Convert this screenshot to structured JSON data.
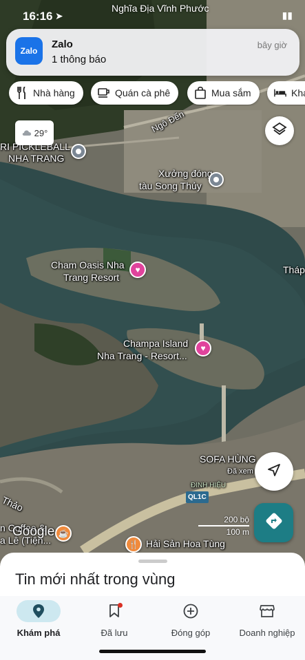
{
  "status_bar": {
    "time": "16:16",
    "location_label": "Nghĩa Địa Vĩnh Phước"
  },
  "notification": {
    "app_icon_text": "Zalo",
    "title": "Zalo",
    "body": "1 thông báo",
    "time": "bây giờ"
  },
  "chips": [
    {
      "label": "Nhà hàng",
      "icon": "restaurant-icon"
    },
    {
      "label": "Quán cà phê",
      "icon": "coffee-icon"
    },
    {
      "label": "Mua sắm",
      "icon": "shopping-bag-icon"
    },
    {
      "label": "Khá",
      "icon": "hotel-icon"
    }
  ],
  "weather": {
    "temp": "29°",
    "icon": "cloud-icon"
  },
  "map_labels": {
    "road_ngo_den": "Ngô Đến",
    "pickleball_1": "RI PICKLEBALL",
    "pickleball_2": "NHA TRANG",
    "shipyard_1": "Xưởng đóng",
    "shipyard_2": "tàu Song Thủy",
    "cham_oasis_1": "Cham Oasis Nha",
    "cham_oasis_2": "Trang Resort",
    "thap": "Tháp",
    "champa_1": "Champa Island",
    "champa_2": "Nha Trang - Resort...",
    "sofa": "SOFA HÙNG",
    "sofa_sub": "Đã xem",
    "dinh_hieu": "ĐINH HIỆU",
    "ql1c": "QL1C",
    "thao": "Thảo",
    "coffee_1": "n Coffee &",
    "coffee_2": "a Lê (Tiện...",
    "hai_san": "Hải Sản Hoa Tùng"
  },
  "scale": {
    "top": "200 bộ",
    "bottom": "100 m"
  },
  "google_logo": "Google",
  "bottom_sheet": {
    "title": "Tin mới nhất trong vùng"
  },
  "nav": [
    {
      "label": "Khám phá",
      "icon": "explore-pin-icon",
      "active": true
    },
    {
      "label": "Đã lưu",
      "icon": "bookmark-icon",
      "active": false
    },
    {
      "label": "Đóng góp",
      "icon": "add-circle-icon",
      "active": false
    },
    {
      "label": "Doanh nghiệp",
      "icon": "storefront-icon",
      "active": false
    }
  ],
  "colors": {
    "river": "#2f4f4f",
    "directions_button": "#1d7d85",
    "active_nav_pill": "#cde8f0",
    "pink_pin": "#e0439c"
  }
}
